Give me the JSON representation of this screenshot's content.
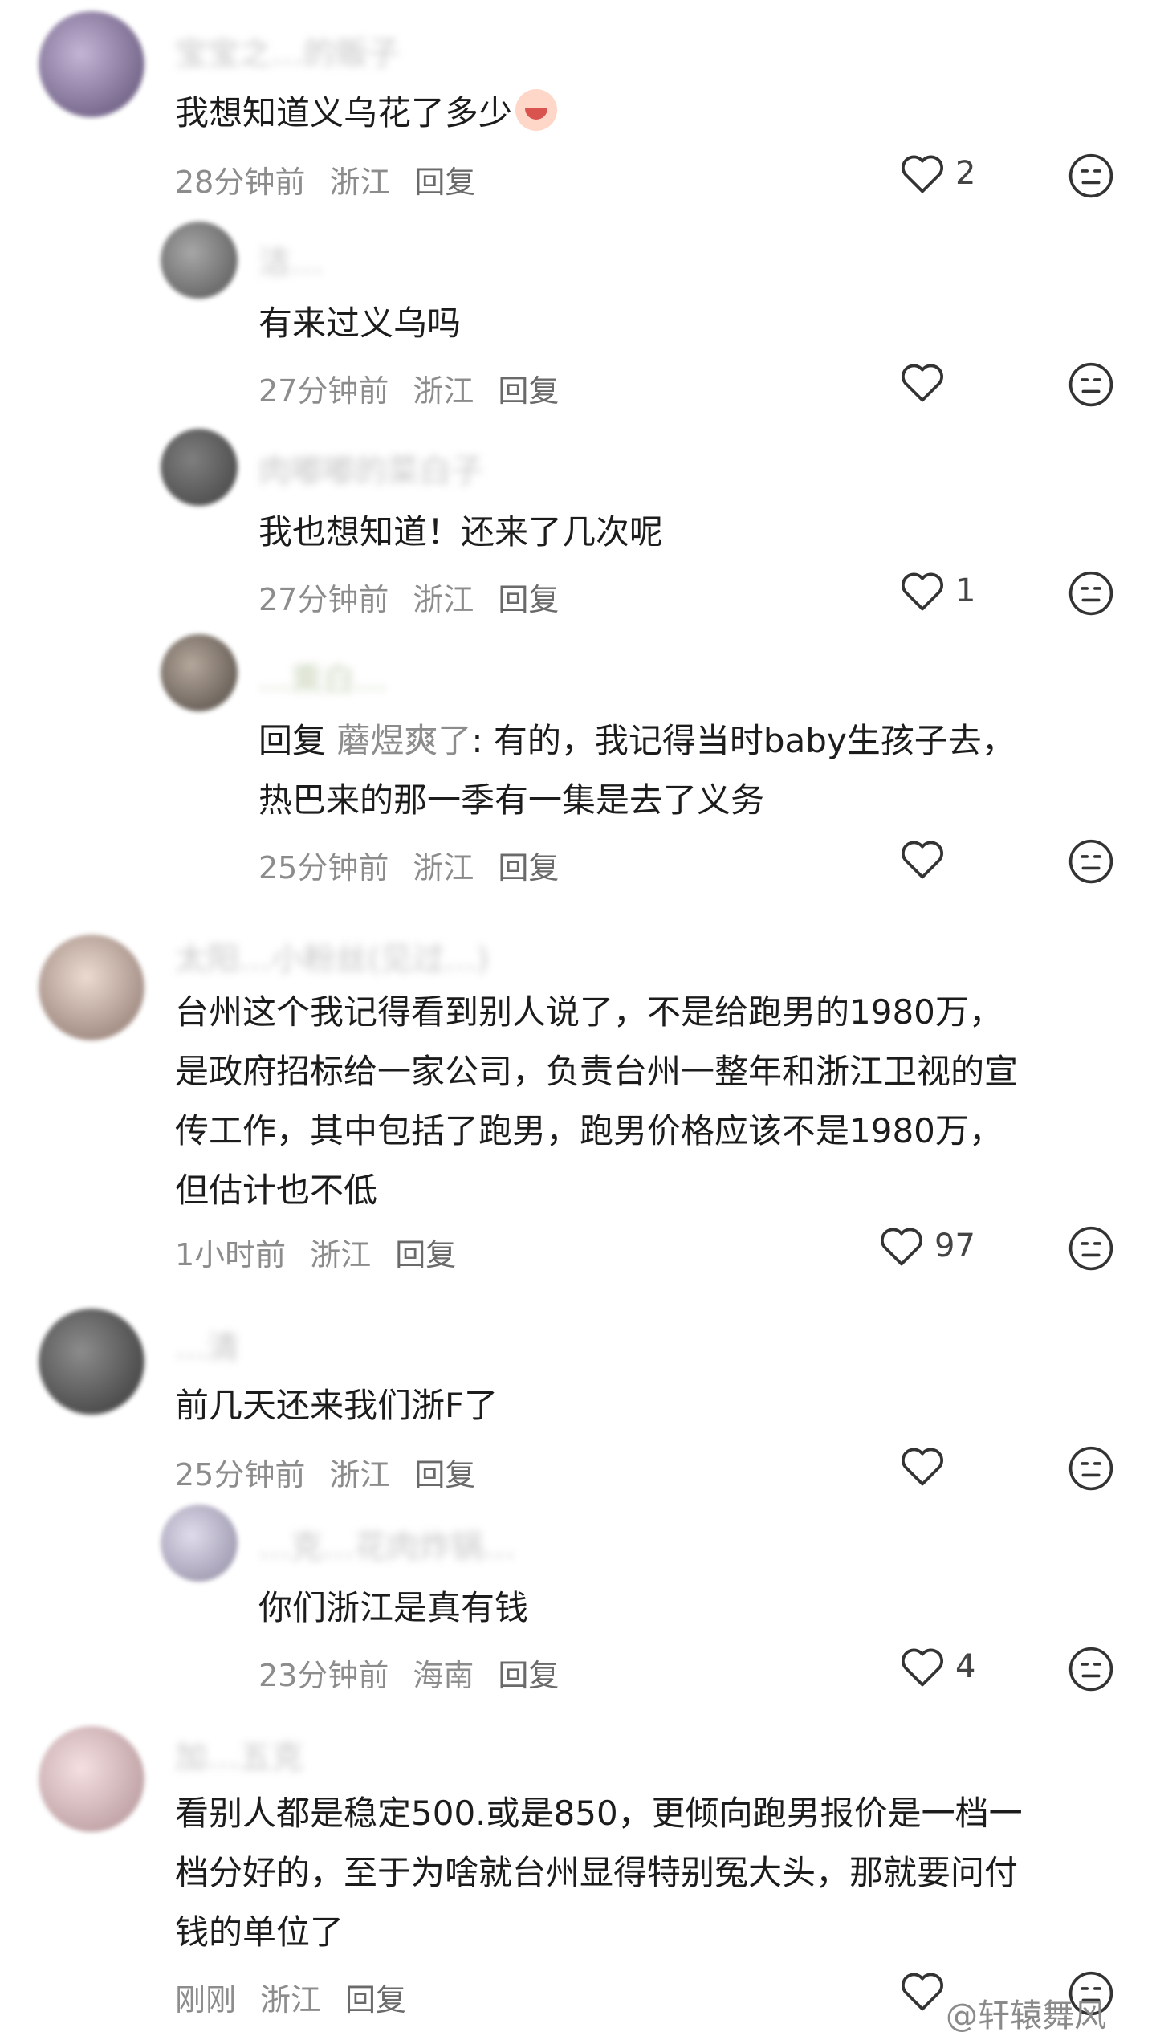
{
  "comments": [
    {
      "level": "top",
      "name": "宝宝之…的贩子",
      "text": "我想知道义乌花了多少",
      "emoji": "crying-face-emoji",
      "time": "28分钟前",
      "location": "浙江",
      "reply": "回复",
      "likes": "2"
    },
    {
      "level": "sub",
      "name": "洁…",
      "text": "有来过义乌吗",
      "time": "27分钟前",
      "location": "浙江",
      "reply": "回复",
      "likes": ""
    },
    {
      "level": "sub",
      "name": "肉嘟嘟的菜白子",
      "text": "我也想知道！还来了几次呢",
      "time": "27分钟前",
      "location": "浙江",
      "reply": "回复",
      "likes": "1"
    },
    {
      "level": "sub",
      "name": "…熏白…",
      "reply_prefix": "回复",
      "reply_target": "蘑煜爽了",
      "text": ": 有的，我记得当时baby生孩子去，\n热巴来的那一季有一集是去了义务",
      "time": "25分钟前",
      "location": "浙江",
      "reply": "回复",
      "likes": ""
    },
    {
      "level": "top",
      "name": "太阳…小粉丝(见过…)",
      "text": "台州这个我记得看到别人说了，不是给跑男的1980万，\n是政府招标给一家公司，负责台州一整年和浙江卫视的宣\n传工作，其中包括了跑男，跑男价格应该不是1980万，\n但估计也不低",
      "time": "1小时前",
      "location": "浙江",
      "reply": "回复",
      "likes": "97"
    },
    {
      "level": "top",
      "name": "…清",
      "text": "前几天还来我们浙F了",
      "time": "25分钟前",
      "location": "浙江",
      "reply": "回复",
      "likes": ""
    },
    {
      "level": "sub",
      "name": "…克…花肉炸锅…",
      "text": "你们浙江是真有钱",
      "time": "23分钟前",
      "location": "海南",
      "reply": "回复",
      "likes": "4"
    },
    {
      "level": "top",
      "name": "加…五克",
      "text": "看别人都是稳定500.或是850，更倾向跑男报价是一档一\n档分好的，至于为啥就台州显得特别冤大头，那就要问付\n钱的单位了",
      "time": "刚刚",
      "location": "浙江",
      "reply": "回复",
      "likes": ""
    }
  ],
  "watermark": "@轩辕舞风",
  "icons": {
    "like": "heart-icon",
    "dislike": "neutral-face-icon"
  }
}
